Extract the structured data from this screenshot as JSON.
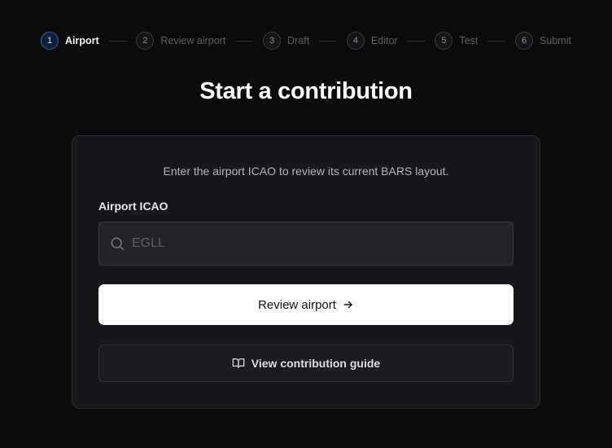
{
  "stepper": {
    "steps": [
      {
        "num": "1",
        "label": "Airport",
        "active": true
      },
      {
        "num": "2",
        "label": "Review airport",
        "active": false
      },
      {
        "num": "3",
        "label": "Draft",
        "active": false
      },
      {
        "num": "4",
        "label": "Editor",
        "active": false
      },
      {
        "num": "5",
        "label": "Test",
        "active": false
      },
      {
        "num": "6",
        "label": "Submit",
        "active": false
      }
    ]
  },
  "page": {
    "title": "Start a contribution"
  },
  "form": {
    "intro": "Enter the airport ICAO to review its current BARS layout.",
    "icao_label": "Airport ICAO",
    "icao_placeholder": "EGLL",
    "icao_value": "",
    "submit_label": "Review airport",
    "guide_label": "View contribution guide"
  },
  "icons": {
    "search": "search-icon",
    "arrow": "arrow-right-icon",
    "book": "book-open-icon"
  },
  "colors": {
    "background": "#0b0b0b",
    "card": "#18181a",
    "active_step": "#2f5fa6",
    "primary_button": "#ffffff"
  }
}
